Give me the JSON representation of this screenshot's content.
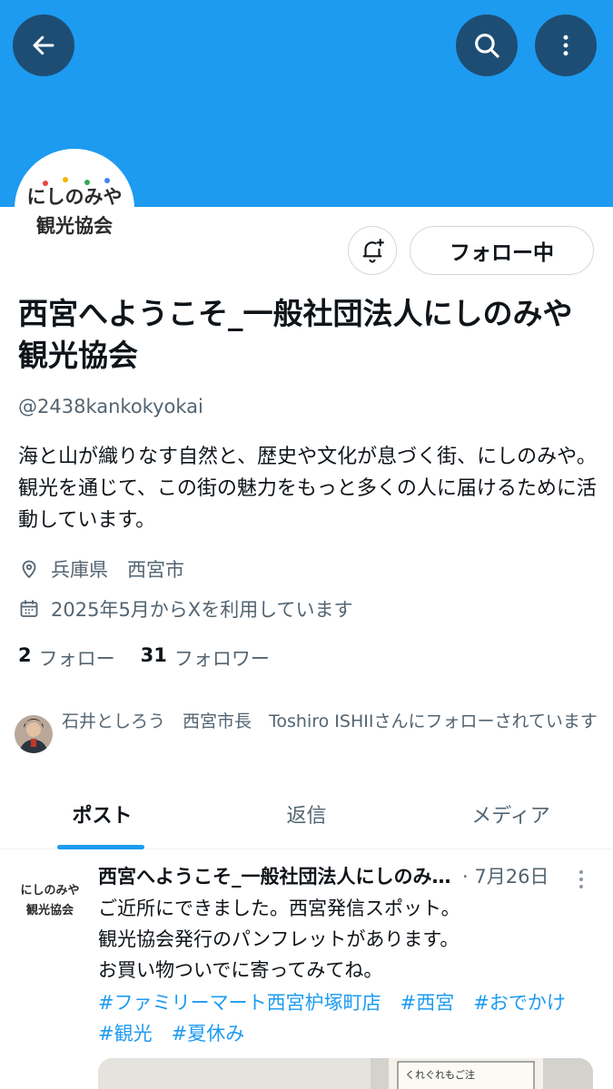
{
  "colors": {
    "banner": "#1d9bf0",
    "accent": "#1d9bf0",
    "text_primary": "#0f1419",
    "text_secondary": "#536471",
    "button_bg": "#1e4d73"
  },
  "header": {
    "back_icon": "arrow-left-icon",
    "search_icon": "search-icon",
    "more_icon": "more-vertical-icon"
  },
  "profile": {
    "avatar_text_line1": "にしのみや",
    "avatar_text_line2": "観光協会",
    "notify_icon": "bell-plus-icon",
    "follow_label": "フォロー中",
    "name": "西宮へようこそ_一般社団法人にしのみや観光協会",
    "handle": "@2438kankokyokai",
    "bio": "海と山が織りなす自然と、歴史や文化が息づく街、にしのみや。 観光を通じて、この街の魅力をもっと多くの人に届けるために活動しています。",
    "location": "兵庫県　西宮市",
    "joined": "2025年5月からXを利用しています",
    "following_count": "2",
    "following_label": "フォロー",
    "followers_count": "31",
    "followers_label": "フォロワー",
    "followed_by": "石井としろう　西宮市長　Toshiro ISHIIさんにフォローされています"
  },
  "tabs": [
    {
      "label": "ポスト",
      "active": true
    },
    {
      "label": "返信",
      "active": false
    },
    {
      "label": "メディア",
      "active": false
    }
  ],
  "post": {
    "author": "西宮へようこそ_一般社団法人にしのみや観光協会",
    "date": "· 7月26日",
    "body": "ご近所にできました。西宮発信スポット。\n観光協会発行のパンフレットがあります。\nお買い物ついでに寄ってみてね。",
    "hashtags": [
      "#ファミリーマート西宮枦塚町店",
      "#西宮",
      "#おでかけ",
      "#観光",
      "#夏休み"
    ],
    "media_text": "くれぐれもご注"
  }
}
